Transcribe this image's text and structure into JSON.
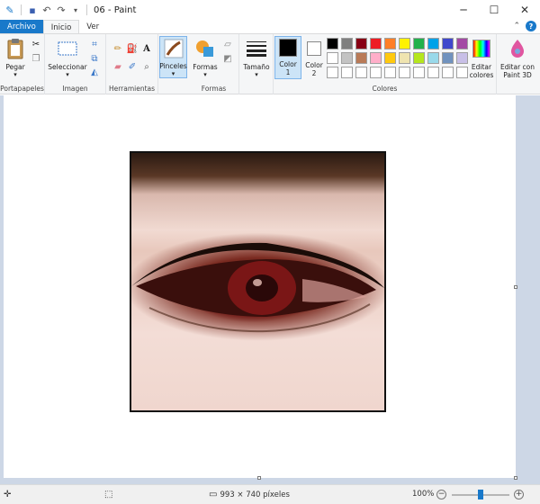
{
  "window": {
    "title": "06 - Paint",
    "controls": [
      "─",
      "☐",
      "✕"
    ]
  },
  "tabs": {
    "file": "Archivo",
    "home": "Inicio",
    "view": "Ver"
  },
  "ribbon": {
    "groups": {
      "clipboard": "Portapapeles",
      "image": "Imagen",
      "tools": "Herramientas",
      "shapes": "Formas",
      "colors": "Colores"
    },
    "paste": "Pegar",
    "select": "Seleccionar",
    "brushes": "Pinceles",
    "shapes": "Formas",
    "size": "Tamaño",
    "color1": "Color 1",
    "color2": "Color 2",
    "edit_colors": "Editar colores",
    "edit_paint3d": "Editar con Paint 3D",
    "palette": [
      "#000000",
      "#7f7f7f",
      "#880015",
      "#ed1c24",
      "#ff7f27",
      "#fff200",
      "#22b14c",
      "#00a2e8",
      "#3f48cc",
      "#a349a4",
      "#ffffff",
      "#c3c3c3",
      "#b97a57",
      "#ffaec9",
      "#ffc90e",
      "#efe4b0",
      "#b5e61d",
      "#99d9ea",
      "#7092be",
      "#c8bfe7",
      "#ffffff",
      "#ffffff",
      "#ffffff",
      "#ffffff",
      "#ffffff",
      "#ffffff",
      "#ffffff",
      "#ffffff",
      "#ffffff",
      "#ffffff"
    ]
  },
  "status": {
    "image_size": "993 × 740 píxeles",
    "zoom": "100%"
  }
}
